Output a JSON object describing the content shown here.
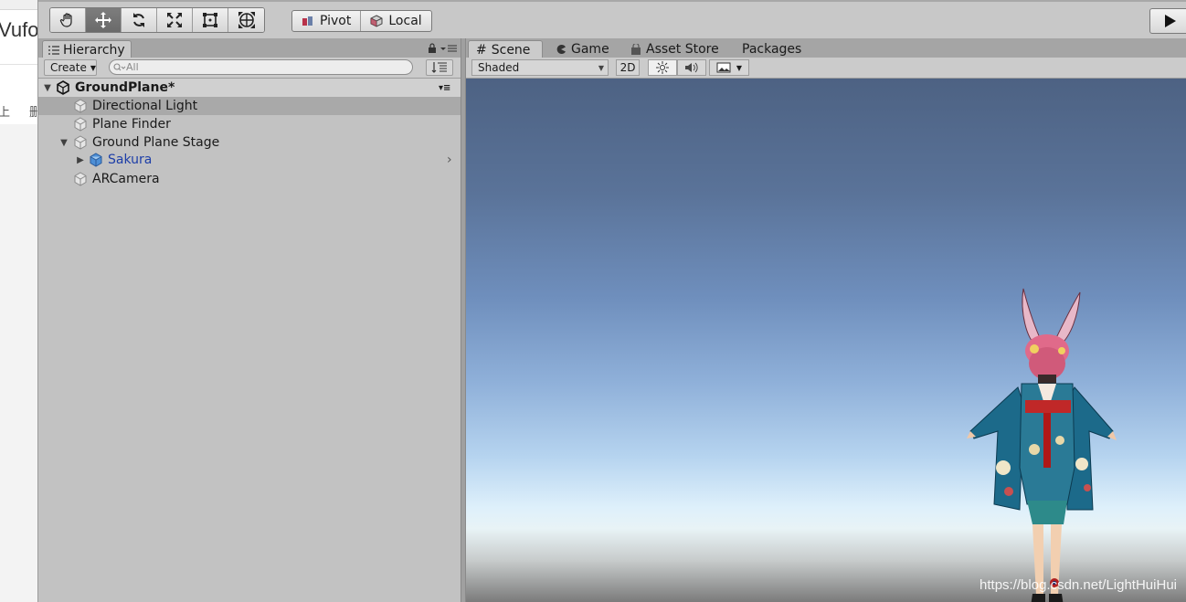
{
  "browser": {
    "title_fragment": "Vufor",
    "left_fragment": "上",
    "right_fragment": "删"
  },
  "toolbar": {
    "tools": [
      {
        "name": "hand-icon"
      },
      {
        "name": "move-icon",
        "active": true
      },
      {
        "name": "rotate-icon"
      },
      {
        "name": "scale-icon"
      },
      {
        "name": "rect-icon"
      },
      {
        "name": "transform-icon"
      }
    ],
    "pivot_label": "Pivot",
    "local_label": "Local",
    "play_icon": "play-icon"
  },
  "hierarchy": {
    "tab_label": "Hierarchy",
    "create_label": "Create",
    "search_placeholder": "All",
    "scene_name": "GroundPlane*",
    "items": [
      {
        "label": "Directional Light",
        "indent": 1,
        "selected": true
      },
      {
        "label": "Plane Finder",
        "indent": 1
      },
      {
        "label": "Ground Plane Stage",
        "indent": 1,
        "expanded": true
      },
      {
        "label": "Sakura",
        "indent": 2,
        "collapsed": true,
        "prefab": true
      },
      {
        "label": "ARCamera",
        "indent": 1
      }
    ]
  },
  "scene": {
    "tabs": [
      {
        "label": "Scene",
        "active": true
      },
      {
        "label": "Game"
      },
      {
        "label": "Asset Store"
      },
      {
        "label": "Packages"
      }
    ],
    "shading_mode": "Shaded",
    "mode_2d_label": "2D",
    "watermark": "https://blog.csdn.net/LightHuiHui"
  },
  "colors": {
    "toolbar_bg": "#c8c8c8",
    "panel_bg": "#c2c2c2",
    "sky_top": "#4d6283",
    "sky_horizon": "#def0fb",
    "prefab_blue": "#1d3ea8"
  }
}
